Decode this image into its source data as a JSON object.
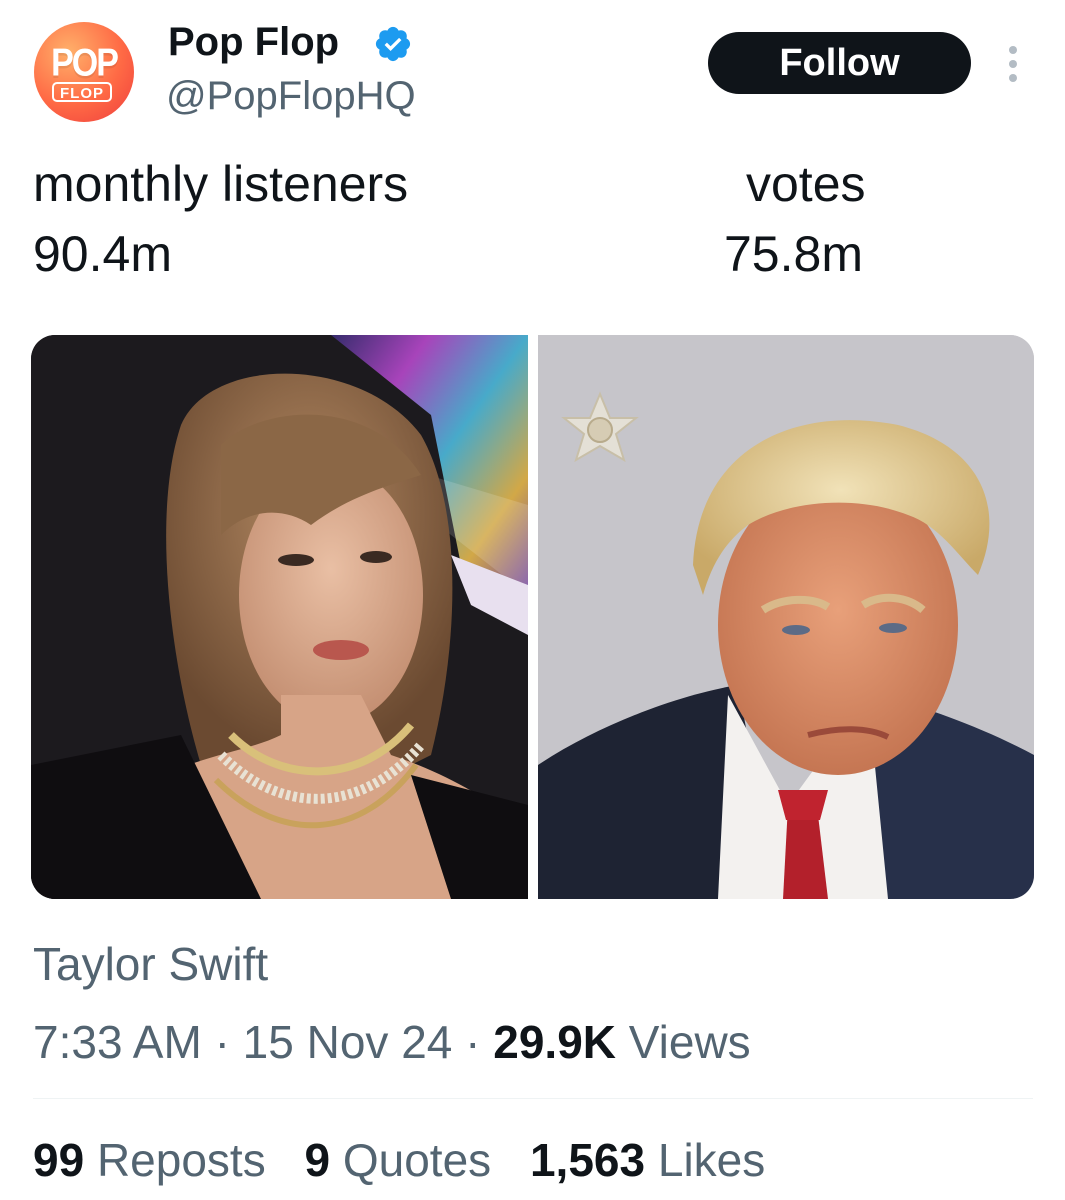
{
  "author": {
    "avatar_text_top": "POP",
    "avatar_text_bottom": "FLOP",
    "display_name": "Pop Flop",
    "verified": true,
    "handle": "@PopFlopHQ"
  },
  "header": {
    "follow_label": "Follow",
    "more_icon": "vertical-ellipsis-icon"
  },
  "tweet": {
    "left_label": "monthly listeners",
    "left_value": "90.4m",
    "right_label": "votes",
    "right_value": "75.8m"
  },
  "footer": {
    "caption": "Taylor Swift",
    "time": "7:33 AM",
    "separator": "·",
    "date": "15 Nov 24",
    "views_count": "29.9K",
    "views_label": "Views",
    "reposts_count": "99",
    "reposts_label": "Reposts",
    "quotes_count": "9",
    "quotes_label": "Quotes",
    "likes_count": "1,563",
    "likes_label": "Likes"
  },
  "colors": {
    "verified_blue": "#1d9bf0",
    "text_primary": "#0f1419",
    "text_secondary": "#536471",
    "follow_bg": "#0f1419"
  }
}
